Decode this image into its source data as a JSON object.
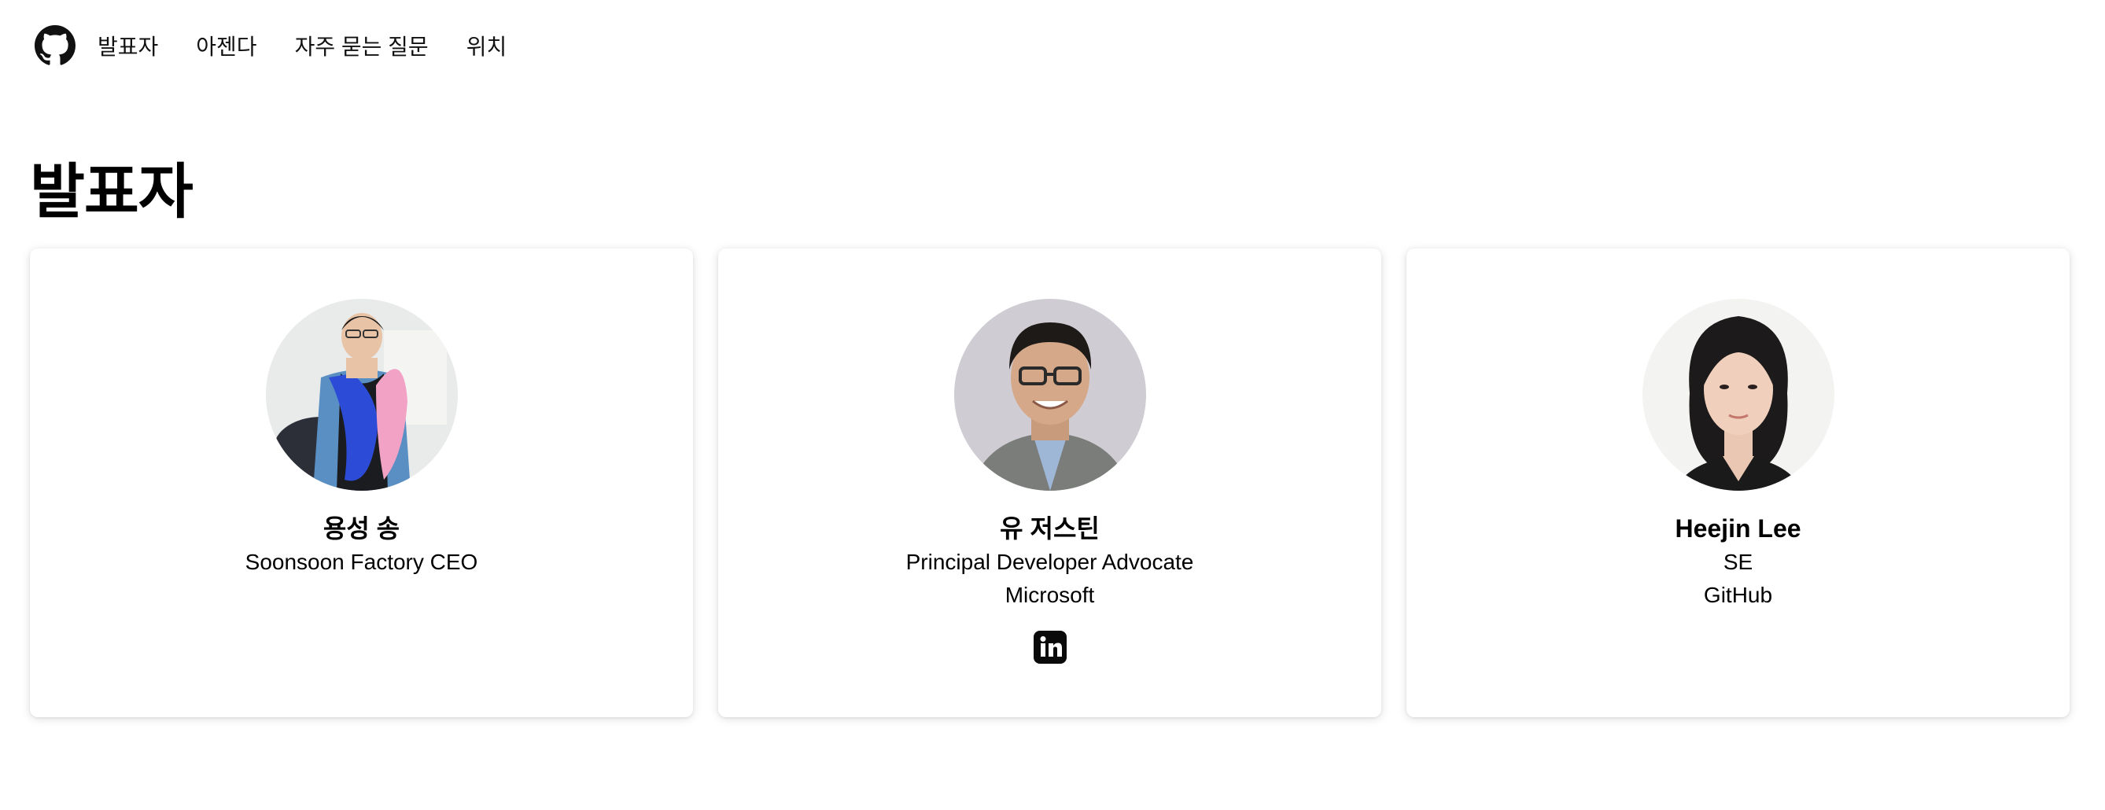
{
  "nav": {
    "logo_icon": "github-icon",
    "items": [
      {
        "label": "발표자"
      },
      {
        "label": "아젠다"
      },
      {
        "label": "자주 묻는 질문"
      },
      {
        "label": "위치"
      }
    ]
  },
  "page": {
    "title": "발표자"
  },
  "speakers": [
    {
      "name": "용성 송",
      "lines": [
        "Soonsoon Factory CEO"
      ]
    },
    {
      "name": "유 저스틴",
      "lines": [
        "Principal Developer Advocate",
        "Microsoft"
      ],
      "social_icon": "linkedin-icon"
    },
    {
      "name": "Heejin Lee",
      "lines": [
        "SE",
        "GitHub"
      ]
    }
  ]
}
